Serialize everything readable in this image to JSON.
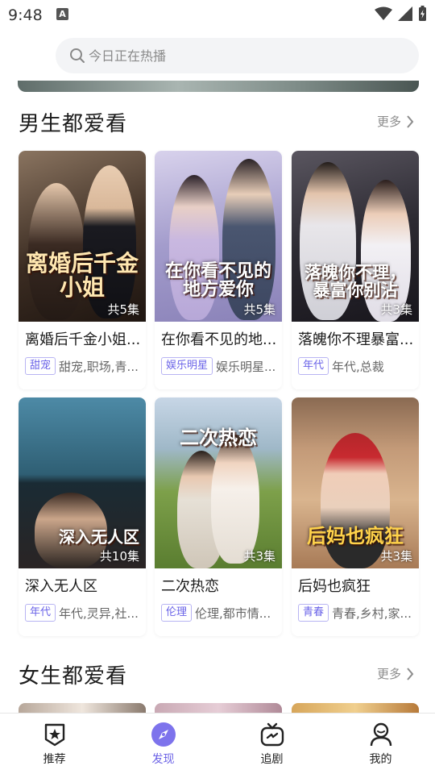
{
  "status_bar": {
    "time": "9:48",
    "notif_icon": "A"
  },
  "search": {
    "placeholder": "今日正在热播"
  },
  "sections": [
    {
      "title": "男生都爱看",
      "more_label": "更多",
      "cards": [
        {
          "title": "离婚后千金小姐...",
          "caption": "离婚后千金小姐",
          "episodes": "共5集",
          "badge": "甜宠",
          "genres": "甜宠,职场,青...",
          "colors": [
            "#6b5a4a",
            "#2a201a",
            "#b48b6a"
          ]
        },
        {
          "title": "在你看不见的地...",
          "caption": "在你看不见的地方爱你",
          "episodes": "共5集",
          "badge": "娱乐明星",
          "genres": "娱乐明星...",
          "colors": [
            "#b9b3d8",
            "#7f78a8",
            "#e8d6e2"
          ]
        },
        {
          "title": "落魄你不理暴富...",
          "caption": "落魄你不理，暴富你别沾",
          "episodes": "共3集",
          "badge": "年代",
          "genres": "年代,总裁",
          "colors": [
            "#3a3a42",
            "#1c1c22",
            "#8b7f7a"
          ]
        }
      ]
    },
    {
      "title": "",
      "more_label": "",
      "cards": [
        {
          "title": "深入无人区",
          "caption": "深入无人区",
          "episodes": "共10集",
          "badge": "年代",
          "genres": "年代,灵异,社...",
          "colors": [
            "#3f6f86",
            "#1f3a48",
            "#6b8a98"
          ]
        },
        {
          "title": "二次热恋",
          "caption": "二次热恋",
          "episodes": "共3集",
          "badge": "伦理",
          "genres": "伦理,都市情...",
          "colors": [
            "#7ea04a",
            "#b9cf8a",
            "#dbe6c6"
          ]
        },
        {
          "title": "后妈也疯狂",
          "caption": "后妈也疯狂",
          "episodes": "共3集",
          "badge": "青春",
          "genres": "青春,乡村,家...",
          "colors": [
            "#c99a72",
            "#8f5b3a",
            "#e9c9a6"
          ]
        }
      ]
    },
    {
      "title": "女生都爱看",
      "more_label": "更多"
    }
  ],
  "nav": {
    "items": [
      {
        "label": "推荐",
        "icon": "shield-star-icon"
      },
      {
        "label": "发现",
        "icon": "compass-icon"
      },
      {
        "label": "追剧",
        "icon": "tv-icon"
      },
      {
        "label": "我的",
        "icon": "user-icon"
      }
    ],
    "active_index": 1,
    "accent": "#6c63e6"
  }
}
